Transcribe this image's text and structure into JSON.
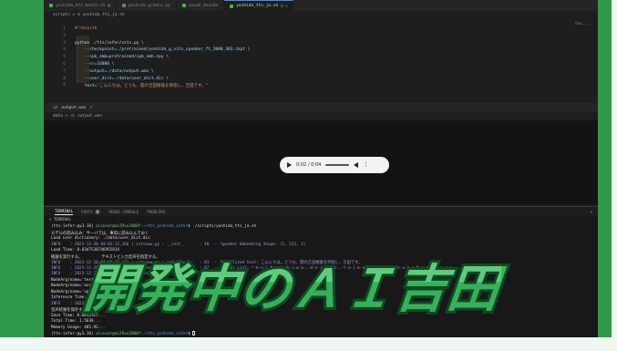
{
  "editor_tabs": [
    {
      "label": "yoshida_tts_batch.sh",
      "active": false,
      "color": "#3fb950",
      "close": "M"
    },
    {
      "label": "yoshida.gradio.py",
      "active": false,
      "color": "#6e7681",
      "close": ""
    },
    {
      "label": "vocab_decode",
      "active": false,
      "color": "#3fb950",
      "close": ""
    },
    {
      "label": "yoshida_tts_ja.sh",
      "active": true,
      "color": "#3fb950",
      "close": "U ×"
    }
  ],
  "breadcrumb": "scripts > $ yoshida_tts_ja.sh",
  "minimap_badge": "You, ...",
  "code_lines": [
    {
      "no": "1",
      "segments": [
        {
          "t": "#!/bin/sh",
          "c": "comment"
        }
      ]
    },
    {
      "no": "2",
      "segments": []
    },
    {
      "no": "3",
      "segments": [
        {
          "t": "python ./tts/infer/vits.py \\",
          "c": "text"
        }
      ]
    },
    {
      "no": "4",
      "segments": [
        {
          "t": "    --checkpoint=./pretrained/yoshida_g_vits_speaker_ft_2000_383.ckpt \\",
          "c": "arg"
        }
      ]
    },
    {
      "no": "5",
      "segments": [
        {
          "t": "    --spk_emb=pretrained/spk_emb.npy \\",
          "c": "arg"
        }
      ]
    },
    {
      "no": "6",
      "segments": [
        {
          "t": "    --sr=16000 \\",
          "c": "arg"
        }
      ]
    },
    {
      "no": "7",
      "segments": [
        {
          "t": "    --output=./data/output.wav \\",
          "c": "arg"
        }
      ]
    },
    {
      "no": "8",
      "segments": [
        {
          "t": "    --user_dict=./data/user_dict.dic \\",
          "c": "arg"
        }
      ]
    },
    {
      "no": "9",
      "segments": [
        {
          "t": "    text=",
          "c": "arg"
        },
        {
          "t": "\"こんにちは。どうも、開の吉田樹雄を目指し、吉田です。\"",
          "c": "str"
        }
      ]
    }
  ],
  "preview_panel": {
    "tab": "output.wav",
    "close": "×",
    "crumb": "data > ◁) output.wav"
  },
  "audio_player": {
    "time": "0:02 / 0:04",
    "menu": "⋮",
    "progress": 0.45
  },
  "terminal_tabs": [
    {
      "label": "TERMINAL",
      "active": true
    },
    {
      "label": "PORTS",
      "active": false,
      "badge": "8"
    },
    {
      "label": "DEBUG CONSOLE",
      "active": false
    },
    {
      "label": "PROBLEMS",
      "active": false
    }
  ],
  "terminal_plus": "+",
  "terminal_title": "> TERMINAL",
  "terminal_lines": [
    [
      {
        "t": "(tts-infer-py3.10) ",
        "c": "white"
      },
      {
        "t": "alsuser@ai29xx2000f",
        "c": "prompt"
      },
      {
        "t": ":~/tts_yoshida_infer",
        "c": "path"
      },
      {
        "t": "$ ./scripts/yoshida_tts_ja.sh",
        "c": "white"
      }
    ],
    [
      {
        "t": "モデルの読み込み：サーバでは、事前に読み込んでおく",
        "c": "white"
      }
    ],
    [
      {
        "t": "Load user dictionary: ./data/user_dict.dic",
        "c": "white"
      }
    ],
    [
      {
        "t": "INFO    : 2023-12-20 04:02:12,166 | vitsnow.py : __init__      : 48  -- Speaker Embedding Shape: (1, 512, 1)",
        "c": "info"
      }
    ],
    [
      {
        "t": "Load Time: 0.8347530746955814",
        "c": "white"
      }
    ],
    [
      {
        "t": "推論を実行する。        テキストと入力音声を指定する。",
        "c": "white"
      }
    ],
    [
      {
        "t": "INFO    : 2023-12-20 04:02:15,171 | vitsnow.py : inference     : 81  -- Normalized text: こんにちは。どうも、開の吉田樹雄を目指し、吉田です。",
        "c": "info"
      }
    ],
    [
      {
        "t": "INFO    : 2023-12-20 04:02:15,174 | vitsnow.py : inference     : 87  -- Symbol List: ^-k-o-[-N-n-i-ch-i-w-a-,-d-o-]-o-m-o-,-t-a-[-k-a-c-u-ts-u-u-[-s-u-k-e-N-n-a-[-k-a-r-e-...",
        "c": "info"
      }
    ],
    [
      {
        "t": "INFO    : 2023-12-20 04:02:15,179 | vitsnow.py : ...",
        "c": "info"
      }
    ],
    [
      {
        "t": "NodeArg(name='text_pa...",
        "c": "white"
      }
    ],
    [
      {
        "t": "NodeArg(name='accent...",
        "c": "white"
      }
    ],
    [
      {
        "t": "NodeArg(name='speaker...",
        "c": "white"
      }
    ],
    [
      {
        "t": "Inference Time: 0.782...",
        "c": "white"
      }
    ],
    [
      {
        "t": "INFO    : 2023-12-2...",
        "c": "info"
      }
    ],
    [
      {
        "t": "音声結果を保存する。",
        "c": "white"
      }
    ],
    [
      {
        "t": "Save Time: 0.0012327...",
        "c": "white"
      }
    ],
    [
      {
        "t": "Total Time: 1.5638...",
        "c": "white"
      }
    ],
    [
      {
        "t": "Memory Usage: 405.92...",
        "c": "white"
      }
    ],
    [
      {
        "t": "(tts-infer-py3.10) ",
        "c": "white"
      },
      {
        "t": "alsuser@ai29xx2000f",
        "c": "prompt"
      },
      {
        "t": ":~/tts_yoshida_infer",
        "c": "path"
      },
      {
        "t": "$ ",
        "c": "white"
      }
    ]
  ],
  "overlay_title": "開発中のＡＩ吉田",
  "colors": {
    "frame_green": "#2f9a4a",
    "title_fill": "#35b15a",
    "title_stroke": "#0f4a22"
  }
}
